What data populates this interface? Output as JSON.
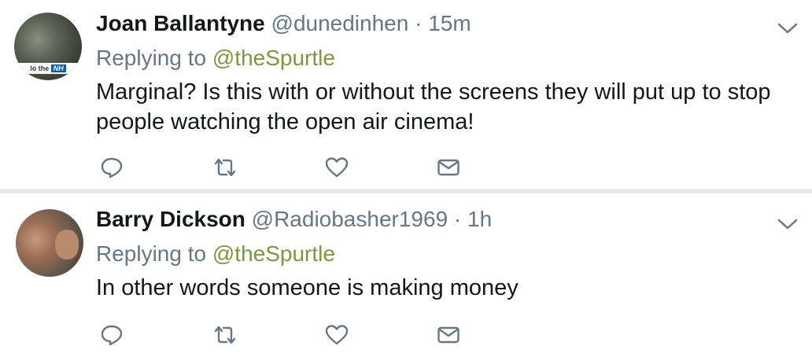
{
  "tweets": [
    {
      "name": "Joan Ballantyne",
      "handle": "@dunedinhen",
      "separator": "·",
      "time": "15m",
      "replying_prefix": "Replying to",
      "replying_to": "@theSpurtle",
      "text": "Marginal? Is this with or without the screens they will put up to stop people watching the open air cinema!",
      "avatar_badge": {
        "prefix": "lo the",
        "badge": "NH"
      }
    },
    {
      "name": "Barry Dickson",
      "handle": "@Radiobasher1969",
      "separator": "·",
      "time": "1h",
      "replying_prefix": "Replying to",
      "replying_to": "@theSpurtle",
      "text": "In other words someone is making money"
    }
  ],
  "icons": {
    "reply": "reply-icon",
    "retweet": "retweet-icon",
    "like": "heart-icon",
    "message": "envelope-icon",
    "more": "chevron-down-icon"
  },
  "colors": {
    "text": "#14171a",
    "muted": "#657786",
    "mention": "#7a9a3a",
    "separator": "#e6ecf0"
  }
}
